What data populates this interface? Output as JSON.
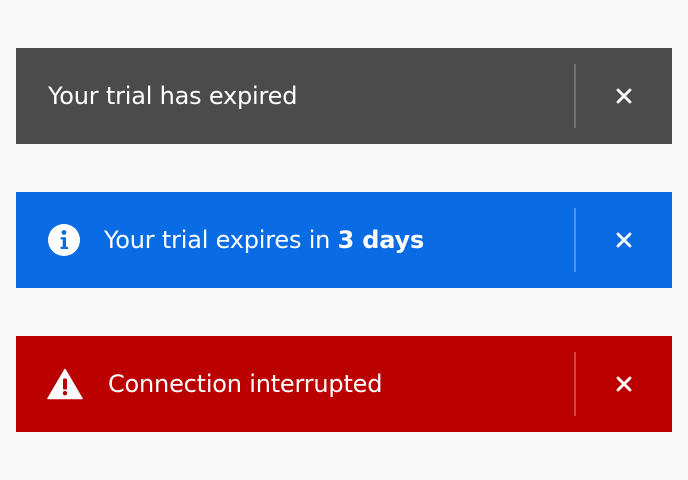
{
  "toasts": [
    {
      "variant": "neutral",
      "color": "#4b4b4b",
      "icon": null,
      "message": "Your trial has expired",
      "close_icon": "close-icon"
    },
    {
      "variant": "info",
      "color": "#0a6ce5",
      "icon": "info-icon",
      "message_prefix": "Your trial expires in ",
      "message_emphasis": "3 days",
      "close_icon": "close-icon"
    },
    {
      "variant": "negative",
      "color": "#bb0000",
      "icon": "alert-triangle-icon",
      "message": "Connection interrupted",
      "close_icon": "close-icon"
    }
  ]
}
